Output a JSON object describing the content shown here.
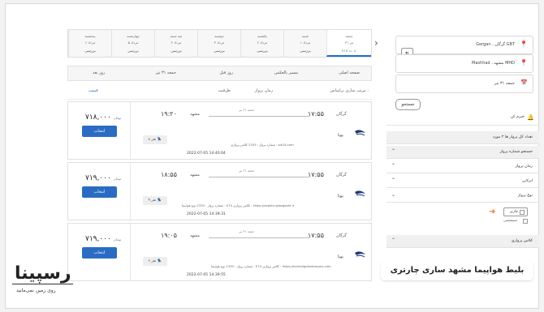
{
  "date_bar": {
    "days": [
      {
        "day": "جمعه",
        "date": "۳۱ تیر",
        "price": "۷۱۸ ت ↓"
      },
      {
        "day": "شنبه",
        "date": "۱ مرداد",
        "price": "بررسی"
      },
      {
        "day": "یکشنبه",
        "date": "۲ مرداد",
        "price": "بررسی"
      },
      {
        "day": "دوشنبه",
        "date": "۳ مرداد",
        "price": "بررسی"
      },
      {
        "day": "سه شنبه",
        "date": "۴ مرداد",
        "price": "بررسی"
      },
      {
        "day": "چهارشنبه",
        "date": "۵ مرداد",
        "price": "بررسی"
      },
      {
        "day": "پنجشنبه",
        "date": "۶ مرداد",
        "price": "بررسی"
      }
    ]
  },
  "sort_bar": {
    "home": "صفحه اصلی",
    "reverse": "مسیر بالعکس",
    "prev_day": "روز قبل",
    "date": "جمعه ۳۱ تیر",
    "next_day": "روز بعد"
  },
  "filter_bar": {
    "sort_label": "مرتب سازی براساس :",
    "flight_time": "زمان پرواز",
    "capacity": "ظرفیت",
    "price": "قیمت"
  },
  "flights": [
    {
      "price": "۷۱۸,۰۰۰",
      "unit": "تومان",
      "select": "انتخاب",
      "dep_time": "۱۷:۵۵",
      "dep_city": "گرگان",
      "arr_time": "۱۹:۲۰",
      "arr_city": "مشهد",
      "date": "جمعه ۳۱ تیر",
      "airline": "پویا",
      "info": "شماره پرواز : 2335  کلاس پروازی : siz24.com",
      "seats": "۸ نفر",
      "timestamp": "2022-07-05 14:40:04"
    },
    {
      "price": "۷۱۹,۰۰۰",
      "unit": "تومان",
      "select": "انتخاب",
      "dep_time": "۱۷:۵۵",
      "dep_city": "گرگان",
      "arr_time": "۱۸:۵۵",
      "arr_city": "مشهد",
      "date": "جمعه ۳۱ تیر",
      "airline": "پویا",
      "info": "شماره پرواز : 2335  نوع هواپیما : E70  کلاس پروازی : https://sepehr.sabzgasht.ir",
      "seats": "۹ نفر",
      "timestamp": "2022-07-05 14:39:31"
    },
    {
      "price": "۷۱۹,۰۰۰",
      "unit": "تومان",
      "select": "انتخاب",
      "dep_time": "۱۷:۵۵",
      "dep_city": "گرگان",
      "arr_time": "۱۹:۰۵",
      "arr_city": "مشهد",
      "date": "جمعه ۳۱ تیر",
      "airline": "پویا",
      "info": "شماره پرواز : 2335  نوع هواپیما : E70  کلاس پروازی : https://komeilgolestanpars.com",
      "seats": "۶ نفر",
      "timestamp": "2022-07-05 14:39:55"
    }
  ],
  "sidebar": {
    "origin": "Gorgan ، گرگان GBT",
    "destination": "Mashhad ، مشهد MHD",
    "date": "جمعه ۳۱ تیر",
    "search_btn": "جستجو",
    "alert": "خبرم کن",
    "total": "تعداد کل پرواز ها ۴ مورد",
    "rows": [
      "جستجو شماره پرواز",
      "زمان پرواز",
      "ایرلاین",
      "نوع پرواز"
    ],
    "charter": "چارتر",
    "system": "سیستمی",
    "flight_class": "کلاس پروازی"
  },
  "caption": "بلیط هواپیما مشهد ساری چارتری",
  "brand": {
    "name": "رسپینا",
    "tagline": "روی زمین نمی‌مانید"
  }
}
